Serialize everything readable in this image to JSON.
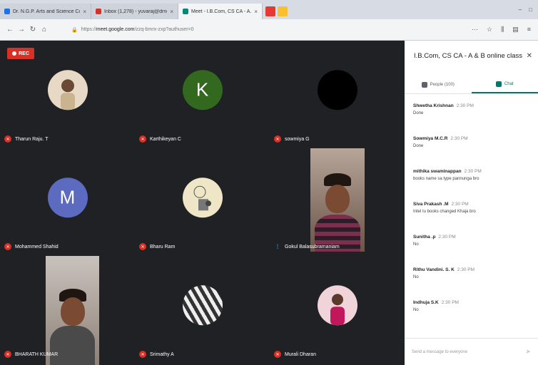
{
  "browser": {
    "tabs": [
      {
        "label": "Dr. N.G.P. Arts and Science Co...",
        "color": "#1a73e8"
      },
      {
        "label": "Inbox (1,278) - yuvaraj@drngp...",
        "color": "#d93025"
      },
      {
        "label": "Meet - I.B.Com, CS CA - A...",
        "color": "#00897b",
        "active": true
      }
    ],
    "url_prefix": "https://",
    "url_domain": "meet.google.com",
    "url_rest": "/zzq-bmrx-zxp?authuser=0"
  },
  "meeting": {
    "rec_label": "REC",
    "tiles": [
      {
        "name": "Tharun Raju. T",
        "type": "photo",
        "bg": "#e8d9c7"
      },
      {
        "name": "Karthikeyan C",
        "type": "letter",
        "letter": "K",
        "bg": "#33691e"
      },
      {
        "name": "sowmiya G",
        "type": "blank",
        "bg": "#000000"
      },
      {
        "name": "Mohammed Shahid",
        "type": "letter",
        "letter": "M",
        "bg": "#5c6bc0"
      },
      {
        "name": "Bharu Ram",
        "type": "photo",
        "bg": "#efe6c8"
      },
      {
        "name": "Gokul Balasubramaniam",
        "type": "video",
        "mic_on": true
      },
      {
        "name": "BHARATH KUMAR",
        "type": "video"
      },
      {
        "name": "Srimathy A",
        "type": "photo",
        "bg": "#bdbdbd"
      },
      {
        "name": "Murali Dharan",
        "type": "photo",
        "bg": "#f1d4d9"
      }
    ]
  },
  "panel": {
    "title": "I.B.Com, CS CA - A & B online class",
    "people_tab": "People (100)",
    "chat_tab": "Chat",
    "messages": [
      {
        "sender": "Shwetha Krishnan",
        "time": "2:30 PM",
        "text": "Done"
      },
      {
        "sender": "Sowmiya M.C.R",
        "time": "2:30 PM",
        "text": "Done"
      },
      {
        "sender": "mithika swaminappan",
        "time": "2:30 PM",
        "text": "books name sa type pannunga bro"
      },
      {
        "sender": "Siva Prakash .M",
        "time": "2:30 PM",
        "text": "Intel Iu books changed Khaja bro"
      },
      {
        "sender": "Sunitha .p",
        "time": "2:30 PM",
        "text": "No"
      },
      {
        "sender": "Rithu Vandini. S. K",
        "time": "2:30 PM",
        "text": "No"
      },
      {
        "sender": "Indhuja S.K",
        "time": "2:30 PM",
        "text": "No"
      }
    ],
    "compose_placeholder": "Send a message to everyone"
  }
}
